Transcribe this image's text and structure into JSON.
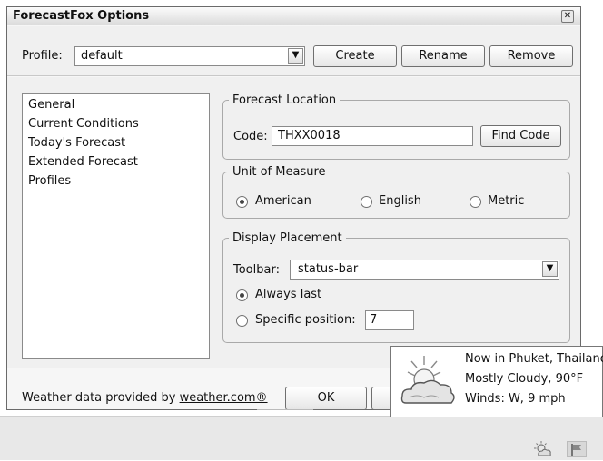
{
  "window": {
    "title": "ForecastFox Options"
  },
  "profile": {
    "label": "Profile:",
    "value": "default",
    "buttons": {
      "create": "Create",
      "rename": "Rename",
      "remove": "Remove"
    }
  },
  "nav": {
    "items": [
      "General",
      "Current Conditions",
      "Today's Forecast",
      "Extended Forecast",
      "Profiles"
    ],
    "selected": "General"
  },
  "location": {
    "legend": "Forecast Location",
    "code_label": "Code:",
    "code_value": "THXX0018",
    "find_button": "Find Code"
  },
  "units": {
    "legend": "Unit of Measure",
    "options": [
      "American",
      "English",
      "Metric"
    ],
    "selected": "American"
  },
  "placement": {
    "legend": "Display Placement",
    "toolbar_label": "Toolbar:",
    "toolbar_value": "status-bar",
    "always_last": "Always last",
    "specific": "Specific position:",
    "position_value": "7",
    "selected": "Always last"
  },
  "footer": {
    "provided_by": "Weather data provided by",
    "link": "weather.com®",
    "ok": "OK"
  },
  "popup": {
    "line1": "Now in Phuket, Thailand",
    "line2": "Mostly Cloudy, 90°F",
    "line3": "Winds: W, 9 mph"
  },
  "icons": {
    "close": "close-icon",
    "dropdown": "chevron-down-icon",
    "weather": "cloudy-weather-icon",
    "status_weather": "weather-status-icon",
    "status_flag": "flag-icon"
  }
}
